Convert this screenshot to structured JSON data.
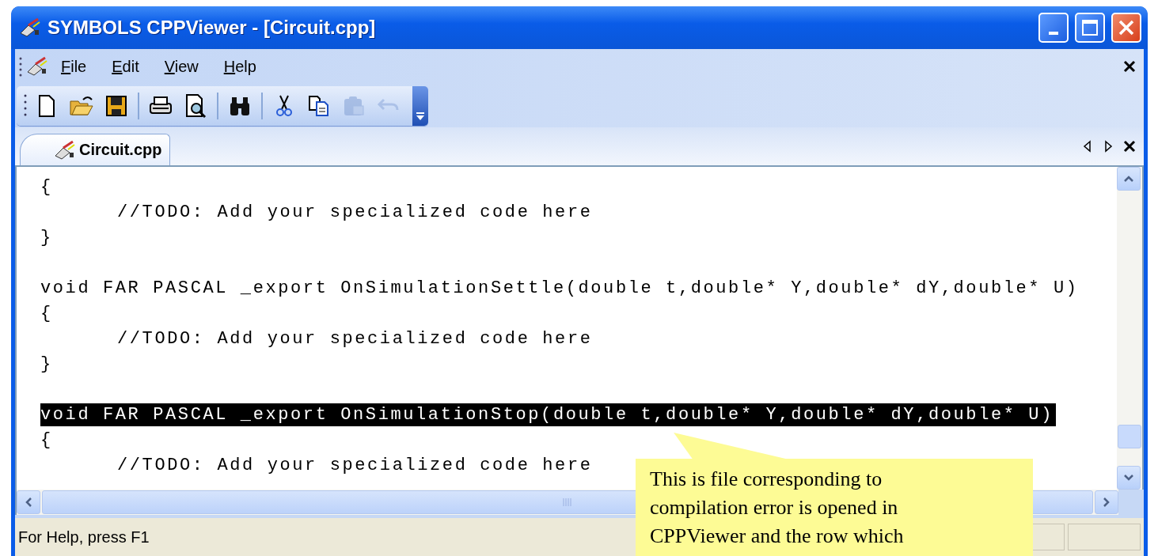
{
  "window": {
    "title": "SYMBOLS CPPViewer - [Circuit.cpp]"
  },
  "menu": [
    {
      "label": "File"
    },
    {
      "label": "Edit"
    },
    {
      "label": "View"
    },
    {
      "label": "Help"
    }
  ],
  "toolbar": [
    {
      "kind": "new",
      "disabled": false
    },
    {
      "kind": "open",
      "disabled": false
    },
    {
      "kind": "save",
      "disabled": false
    },
    {
      "kind": "separator"
    },
    {
      "kind": "print",
      "disabled": false
    },
    {
      "kind": "preview",
      "disabled": false
    },
    {
      "kind": "separator"
    },
    {
      "kind": "find",
      "disabled": false
    },
    {
      "kind": "separator"
    },
    {
      "kind": "cut",
      "disabled": false
    },
    {
      "kind": "copy",
      "disabled": false
    },
    {
      "kind": "paste",
      "disabled": true
    },
    {
      "kind": "undo",
      "disabled": true
    }
  ],
  "tabs": [
    {
      "label": "Circuit.cpp",
      "selected": true
    }
  ],
  "code_lines": [
    {
      "kind": "line",
      "text": "{",
      "selected": false
    },
    {
      "kind": "indented",
      "text": "//TODO: Add your specialized code here",
      "selected": false
    },
    {
      "kind": "line",
      "text": "}",
      "selected": false
    },
    {
      "kind": "blank"
    },
    {
      "kind": "line",
      "text": "void FAR PASCAL _export OnSimulationSettle(double t,double* Y,double* dY,double* U)",
      "selected": false
    },
    {
      "kind": "line",
      "text": "{",
      "selected": false
    },
    {
      "kind": "indented",
      "text": "//TODO: Add your specialized code here",
      "selected": false
    },
    {
      "kind": "line",
      "text": "}",
      "selected": false
    },
    {
      "kind": "blank"
    },
    {
      "kind": "line",
      "text": "void FAR PASCAL _export OnSimulationStop(double t,double* Y,double* dY,double* U)",
      "selected": true
    },
    {
      "kind": "line",
      "text": "{",
      "selected": false
    },
    {
      "kind": "indented",
      "text": "//TODO: Add your specialized code here",
      "selected": false
    }
  ],
  "status_bar": {
    "text": "For Help, press F1"
  },
  "callout": {
    "text": "This is file corresponding to compilation error is opened in CPPViewer and the row which"
  }
}
